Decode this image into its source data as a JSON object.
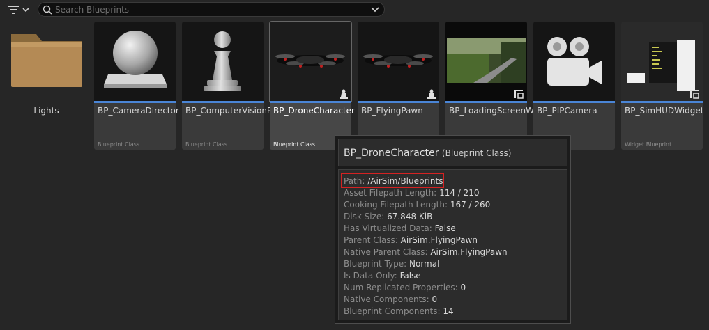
{
  "toolbar": {
    "filter_icon": "filter-lines-icon",
    "search": {
      "placeholder": "Search Blueprints",
      "value": "",
      "icon": "search-icon"
    }
  },
  "folders": [
    {
      "label": "Lights",
      "icon": "folder-icon"
    }
  ],
  "assets": [
    {
      "name": "BP_CameraDirector",
      "type": "Blueprint Class",
      "thumb": "sphere-on-pedestal"
    },
    {
      "name": "BP_ComputerVisionPawn",
      "type": "Blueprint Class",
      "thumb": "pawn-piece"
    },
    {
      "name": "BP_DroneCharacter",
      "type": "Blueprint Class",
      "thumb": "drone",
      "selected": true
    },
    {
      "name": "BP_FlyingPawn",
      "type": "",
      "thumb": "drone"
    },
    {
      "name": "BP_LoadingScreenWidget",
      "type": "",
      "thumb": "landscape-road"
    },
    {
      "name": "BP_PIPCamera",
      "type": "",
      "thumb": "movie-camera"
    },
    {
      "name": "BP_SimHUDWidget",
      "type": "Widget Blueprint",
      "thumb": "hud-widget"
    }
  ],
  "tooltip": {
    "title": "BP_DroneCharacter",
    "subtitle": "(Blueprint Class)",
    "properties": [
      {
        "key": "Path:",
        "value": "/AirSim/Blueprints"
      },
      {
        "key": "Asset Filepath Length:",
        "value": "114 / 210"
      },
      {
        "key": "Cooking Filepath Length:",
        "value": "167 / 260"
      },
      {
        "key": "Disk Size:",
        "value": "67.848 KiB"
      },
      {
        "key": "Has Virtualized Data:",
        "value": "False"
      },
      {
        "key": "Parent Class:",
        "value": "AirSim.FlyingPawn"
      },
      {
        "key": "Native Parent Class:",
        "value": "AirSim.FlyingPawn"
      },
      {
        "key": "Blueprint Type:",
        "value": "Normal"
      },
      {
        "key": "Is Data Only:",
        "value": "False"
      },
      {
        "key": "Num Replicated Properties:",
        "value": "0"
      },
      {
        "key": "Native Components:",
        "value": "0"
      },
      {
        "key": "Blueprint Components:",
        "value": "14"
      }
    ]
  },
  "colors": {
    "accent_bar": "#4a85d6",
    "highlight_box": "#d42222"
  }
}
